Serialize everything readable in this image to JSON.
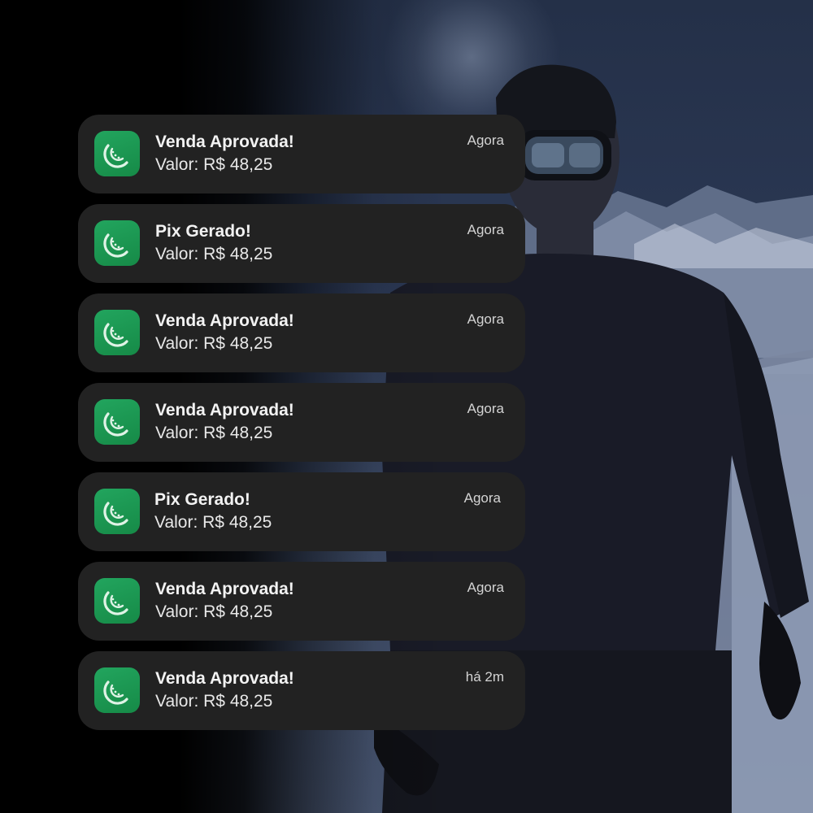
{
  "notifications": [
    {
      "title": "Venda Aprovada!",
      "subtitle": "Valor: R$ 48,25",
      "time": "Agora",
      "icon": "watermelon-slice-icon"
    },
    {
      "title": "Pix Gerado!",
      "subtitle": "Valor: R$ 48,25",
      "time": "Agora",
      "icon": "watermelon-slice-icon"
    },
    {
      "title": "Venda Aprovada!",
      "subtitle": "Valor: R$ 48,25",
      "time": "Agora",
      "icon": "watermelon-slice-icon"
    },
    {
      "title": "Venda Aprovada!",
      "subtitle": "Valor: R$ 48,25",
      "time": "Agora",
      "icon": "watermelon-slice-icon"
    },
    {
      "title": "Pix Gerado!",
      "subtitle": "Valor: R$ 48,25",
      "time": "Agora",
      "icon": "watermelon-slice-icon"
    },
    {
      "title": "Venda Aprovada!",
      "subtitle": "Valor: R$ 48,25",
      "time": "Agora",
      "icon": "watermelon-slice-icon"
    },
    {
      "title": "Venda Aprovada!",
      "subtitle": "Valor: R$ 48,25",
      "time": "há 2m",
      "icon": "watermelon-slice-icon"
    }
  ],
  "colors": {
    "card_background": "#222222",
    "icon_green": "#1a9a52",
    "text_primary": "#f2f2f2",
    "text_secondary": "#d4d4d4"
  }
}
